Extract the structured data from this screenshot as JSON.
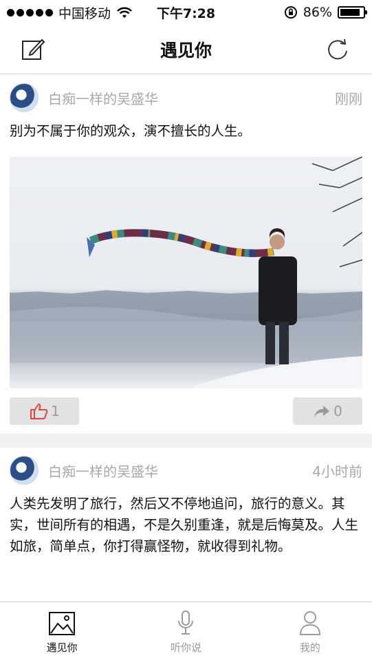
{
  "status_bar": {
    "carrier": "中国移动",
    "time": "下午7:28",
    "battery_text": "86%",
    "battery_level": 0.86
  },
  "nav": {
    "title": "遇见你",
    "left_icon": "compose-icon",
    "right_icon": "refresh-icon"
  },
  "posts": [
    {
      "username": "白痴一样的吴盛华",
      "time": "刚刚",
      "text": "别为不属于你的观众，演不擅长的人生。",
      "has_image": true,
      "likes": "1",
      "shares": "0"
    },
    {
      "username": "白痴一样的吴盛华",
      "time": "4小时前",
      "text": "人类先发明了旅行，然后又不停地追问，旅行的意义。其实，世间所有的相遇，不是久别重逢，就是后悔莫及。人生如旅，简单点，你打得赢怪物，就收得到礼物。"
    }
  ],
  "tabs": [
    {
      "label": "遇见你",
      "icon": "picture-icon",
      "active": true
    },
    {
      "label": "听你说",
      "icon": "microphone-icon",
      "active": false
    },
    {
      "label": "我的",
      "icon": "person-icon",
      "active": false
    }
  ],
  "colors": {
    "secondary_text": "#a8a8a8",
    "button_bg": "#e2e2e2",
    "like_red": "#e2463b"
  }
}
